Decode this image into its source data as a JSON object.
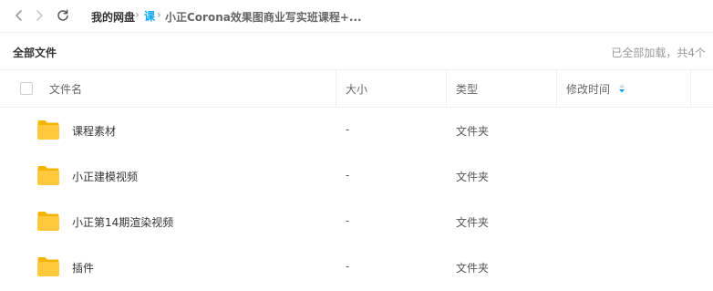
{
  "nav": {
    "back_icon": "chevron-left-icon",
    "forward_icon": "chevron-right-icon",
    "refresh_icon": "refresh-icon"
  },
  "breadcrumb": {
    "root": "我的网盘",
    "separator": "›",
    "middle": "课",
    "current": "小正Corona效果图商业写实班课程+..."
  },
  "header": {
    "title": "全部文件",
    "load_status": "已全部加载，共4个"
  },
  "table": {
    "columns": [
      "文件名",
      "大小",
      "类型",
      "修改时间"
    ],
    "sort_icon": "sort-desc-icon",
    "rows": [
      {
        "name": "课程素材",
        "size": "-",
        "type": "文件夹",
        "modified": ""
      },
      {
        "name": "小正建模视频",
        "size": "-",
        "type": "文件夹",
        "modified": ""
      },
      {
        "name": "小正第14期渲染视频",
        "size": "-",
        "type": "文件夹",
        "modified": ""
      },
      {
        "name": "插件",
        "size": "-",
        "type": "文件夹",
        "modified": ""
      }
    ]
  },
  "colors": {
    "accent": "#06a7ff",
    "folder": "#ffc83d",
    "folder_dark": "#f5b400",
    "border": "#f0f0f0"
  }
}
